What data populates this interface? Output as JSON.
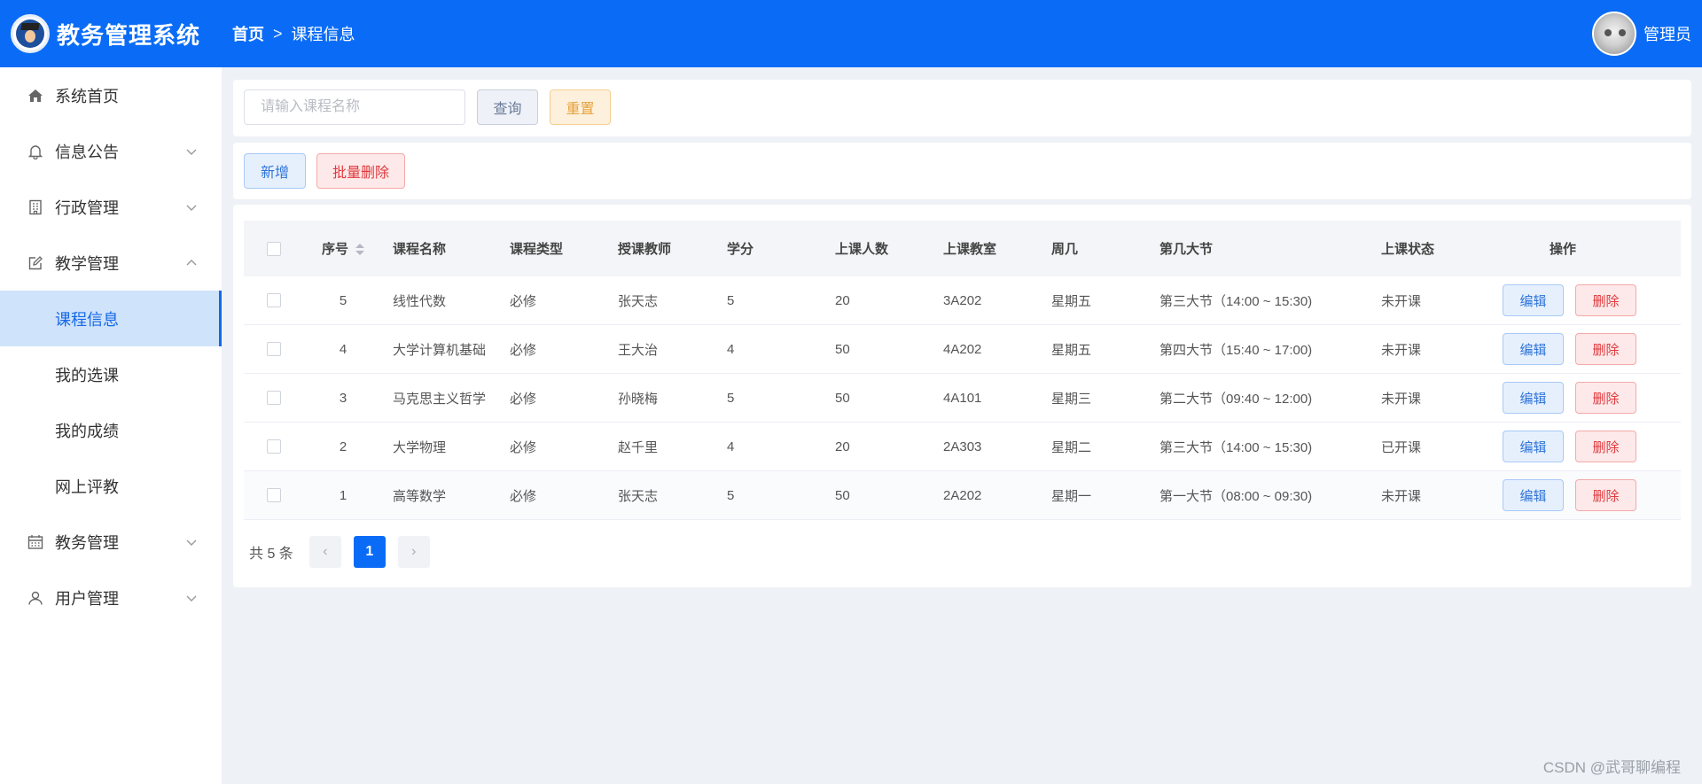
{
  "app": {
    "title": "教务管理系统"
  },
  "breadcrumb": {
    "home": "首页",
    "separator": ">",
    "current": "课程信息"
  },
  "user": {
    "name": "管理员"
  },
  "sidebar": {
    "items": [
      {
        "label": "系统首页",
        "icon": "home-icon",
        "expandable": false
      },
      {
        "label": "信息公告",
        "icon": "bell-icon",
        "expandable": true
      },
      {
        "label": "行政管理",
        "icon": "building-icon",
        "expandable": true
      },
      {
        "label": "教学管理",
        "icon": "edit-icon",
        "expandable": true,
        "expanded": true,
        "children": [
          "课程信息",
          "我的选课",
          "我的成绩",
          "网上评教"
        ],
        "active_child": "课程信息"
      },
      {
        "label": "教务管理",
        "icon": "calendar-icon",
        "expandable": true
      },
      {
        "label": "用户管理",
        "icon": "user-icon",
        "expandable": true
      }
    ]
  },
  "search": {
    "placeholder": "请输入课程名称",
    "value": "",
    "query_label": "查询",
    "reset_label": "重置"
  },
  "actions": {
    "add_label": "新增",
    "batch_delete_label": "批量删除"
  },
  "table": {
    "headers": {
      "seq": "序号",
      "name": "课程名称",
      "type": "课程类型",
      "teacher": "授课教师",
      "credit": "学分",
      "people": "上课人数",
      "room": "上课教室",
      "week": "周几",
      "section": "第几大节",
      "status": "上课状态",
      "ops": "操作"
    },
    "edit_label": "编辑",
    "delete_label": "删除",
    "rows": [
      {
        "seq": "5",
        "name": "线性代数",
        "type": "必修",
        "teacher": "张天志",
        "credit": "5",
        "people": "20",
        "room": "3A202",
        "week": "星期五",
        "section": "第三大节（14:00 ~ 15:30)",
        "status": "未开课"
      },
      {
        "seq": "4",
        "name": "大学计算机基础",
        "type": "必修",
        "teacher": "王大治",
        "credit": "4",
        "people": "50",
        "room": "4A202",
        "week": "星期五",
        "section": "第四大节（15:40 ~ 17:00)",
        "status": "未开课"
      },
      {
        "seq": "3",
        "name": "马克思主义哲学",
        "type": "必修",
        "teacher": "孙晓梅",
        "credit": "5",
        "people": "50",
        "room": "4A101",
        "week": "星期三",
        "section": "第二大节（09:40 ~ 12:00)",
        "status": "未开课"
      },
      {
        "seq": "2",
        "name": "大学物理",
        "type": "必修",
        "teacher": "赵千里",
        "credit": "4",
        "people": "20",
        "room": "2A303",
        "week": "星期二",
        "section": "第三大节（14:00 ~ 15:30)",
        "status": "已开课"
      },
      {
        "seq": "1",
        "name": "高等数学",
        "type": "必修",
        "teacher": "张天志",
        "credit": "5",
        "people": "50",
        "room": "2A202",
        "week": "星期一",
        "section": "第一大节（08:00 ~ 09:30)",
        "status": "未开课"
      }
    ]
  },
  "pagination": {
    "total_text": "共 5 条",
    "current_page": "1",
    "prev": "‹",
    "next": "›"
  },
  "watermark": "CSDN @武哥聊编程",
  "colors": {
    "brand": "#0a6cf6",
    "active_menu_bg": "#cfe3fb",
    "warning": "#e6a23c",
    "danger": "#e0393e"
  }
}
